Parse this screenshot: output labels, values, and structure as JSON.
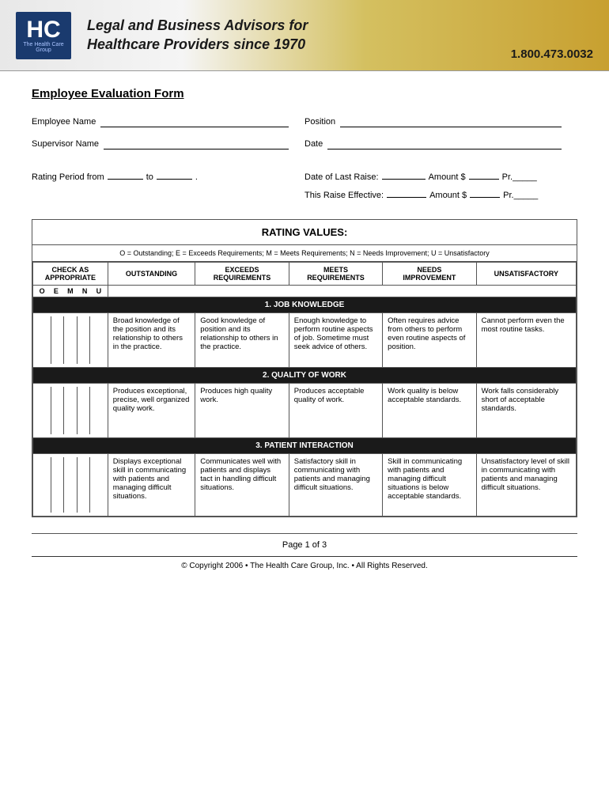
{
  "header": {
    "logo_letters": "HC",
    "logo_subtext": "The Health Care Group",
    "tagline_line1": "Legal and Business Advisors for",
    "tagline_line2": "Healthcare Providers since 1970",
    "phone": "1.800.473.0032"
  },
  "form": {
    "title": "Employee Evaluation Form",
    "fields": {
      "employee_name_label": "Employee Name",
      "position_label": "Position",
      "supervisor_name_label": "Supervisor Name",
      "date_label": "Date"
    },
    "rating_period": {
      "label": "Rating Period from",
      "from_blank": "_____",
      "to_label": "to",
      "to_blank": "_____."
    },
    "date_last_raise": {
      "label": "Date of Last Raise:",
      "blank1": "________",
      "amount_label": "Amount $",
      "blank2": "_____",
      "pr_label": "Pr._____"
    },
    "this_raise": {
      "label": "This Raise Effective:",
      "blank1": "_______",
      "amount_label": "Amount $",
      "blank2": "_____",
      "pr_label": "Pr._____"
    }
  },
  "rating_values": {
    "title": "RATING VALUES:",
    "legend": "O = Outstanding; E = Exceeds Requirements; M = Meets Requirements; N = Needs Improvement; U = Unsatisfactory"
  },
  "table": {
    "headers": {
      "check_as": "CHECK AS\nAPPROPRIATE",
      "outstanding": "OUTSTANDING",
      "exceeds": "EXCEEDS\nREQUIREMENTS",
      "meets": "MEETS\nREQUIREMENTS",
      "needs": "NEEDS\nIMPROVEMENT",
      "unsatisfactory": "UNSATISFACTORY"
    },
    "oemntu": [
      "O",
      "E",
      "M",
      "N",
      "U"
    ],
    "sections": [
      {
        "title": "1. JOB KNOWLEDGE",
        "rows": [
          {
            "outstanding": "Broad knowledge of the position and its relationship to others in the practice.",
            "exceeds": "Good knowledge of position and its relationship to others in the practice.",
            "meets": "Enough knowledge to perform routine aspects of job. Sometime must seek advice of others.",
            "needs": "Often requires advice from others to perform even routine aspects of position.",
            "unsatisfactory": "Cannot perform even the most routine tasks."
          }
        ]
      },
      {
        "title": "2. QUALITY OF WORK",
        "rows": [
          {
            "outstanding": "Produces exceptional, precise, well organized quality work.",
            "exceeds": "Produces high quality work.",
            "meets": "Produces acceptable quality of work.",
            "needs": "Work quality is below acceptable standards.",
            "unsatisfactory": "Work falls considerably short of acceptable standards."
          }
        ]
      },
      {
        "title": "3. PATIENT INTERACTION",
        "rows": [
          {
            "outstanding": "Displays exceptional skill in communicating with patients and managing difficult situations.",
            "exceeds": "Communicates well with patients and displays tact in handling difficult situations.",
            "meets": "Satisfactory skill in communicating with patients and managing difficult situations.",
            "needs": "Skill in communicating with patients and managing difficult situations is below acceptable standards.",
            "unsatisfactory": "Unsatisfactory level of skill in communicating with patients and managing difficult situations."
          }
        ]
      }
    ]
  },
  "footer": {
    "page_info": "Page 1 of 3",
    "copyright": "© Copyright 2006 • The Health Care Group, Inc. • All Rights Reserved."
  }
}
